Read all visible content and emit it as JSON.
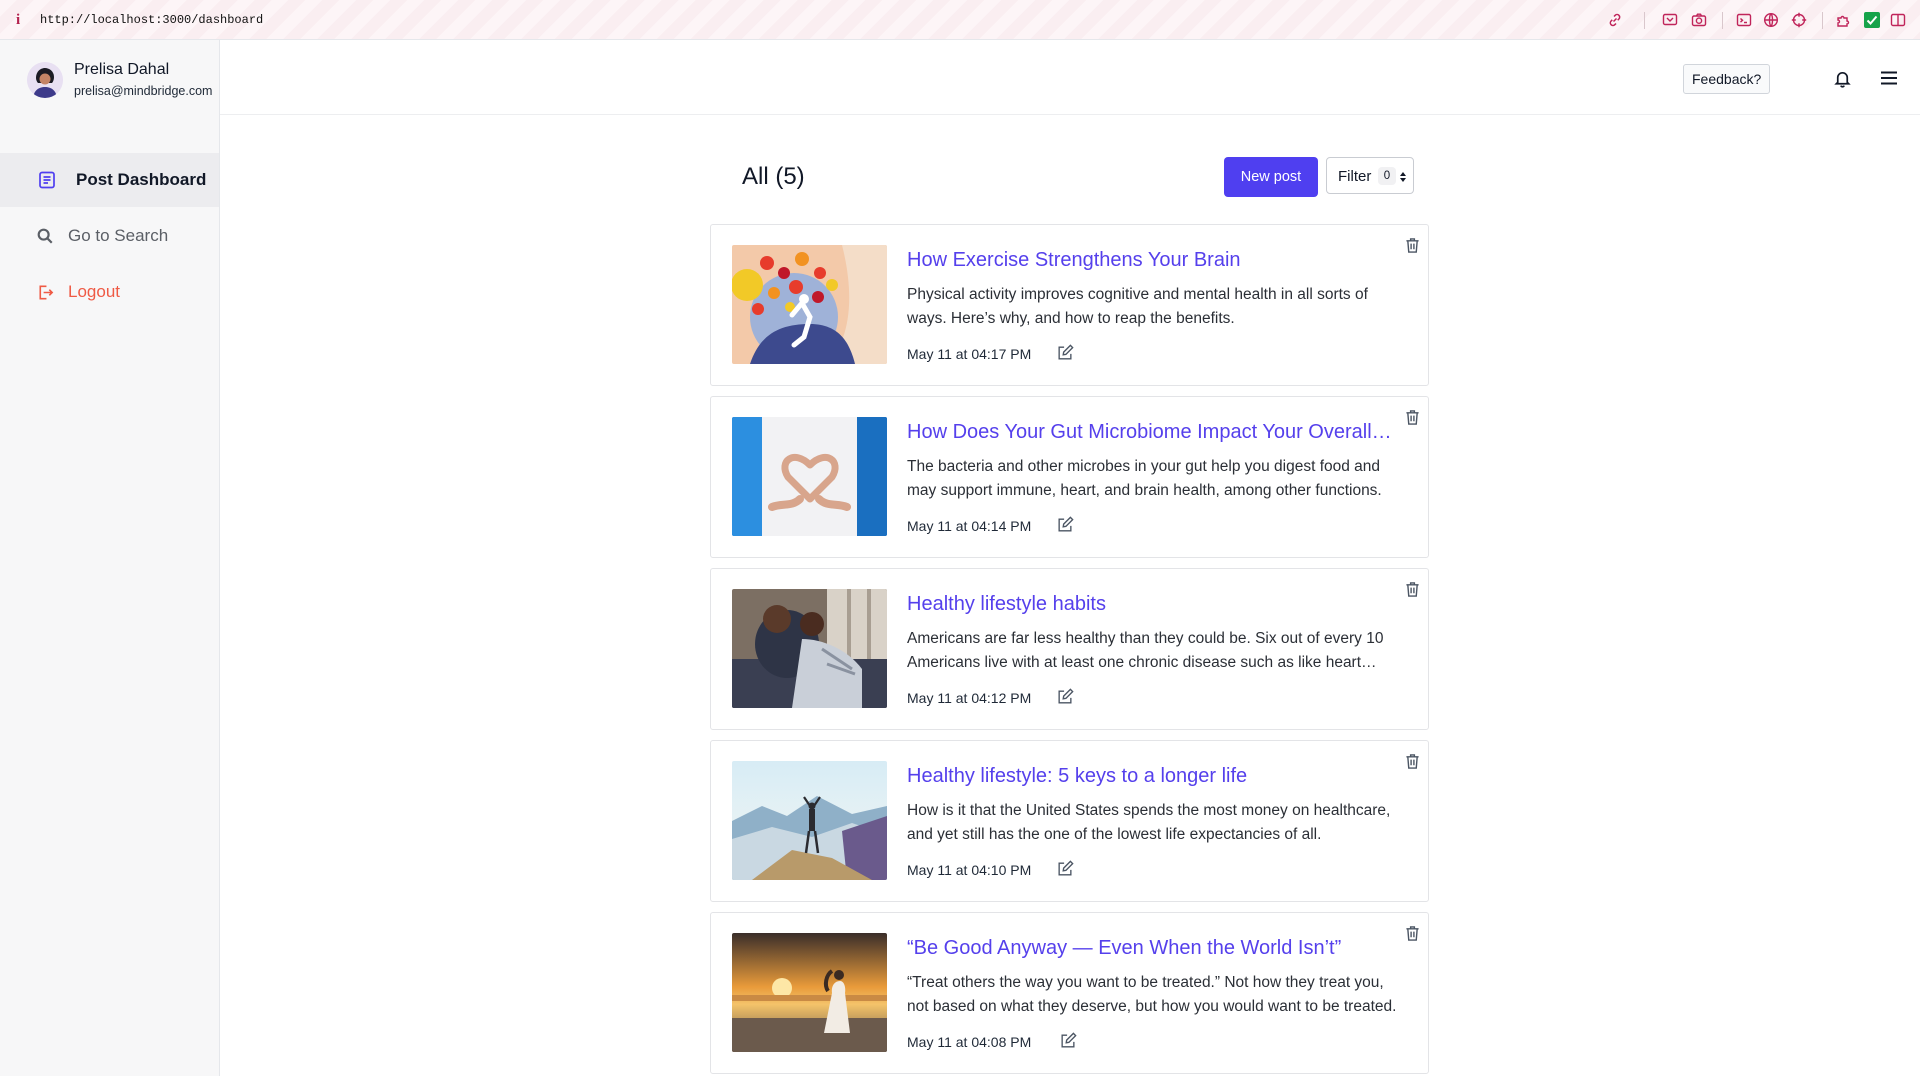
{
  "browser": {
    "url": "http://localhost:3000/dashboard"
  },
  "user": {
    "name": "Prelisa Dahal",
    "email": "prelisa@mindbridge.com"
  },
  "sidebar": {
    "items": [
      {
        "label": "Post Dashboard",
        "icon": "document-icon",
        "active": true
      },
      {
        "label": "Go to Search",
        "icon": "search-icon",
        "active": false
      },
      {
        "label": "Logout",
        "icon": "logout-icon",
        "active": false,
        "color": "#ef5a45"
      }
    ]
  },
  "header": {
    "feedback_label": "Feedback?"
  },
  "main": {
    "title": "All (5)",
    "new_post_label": "New post",
    "filter_label": "Filter",
    "filter_count": "0"
  },
  "posts": [
    {
      "title": "How Exercise Strengthens Your Brain",
      "excerpt": "Physical activity improves cognitive and mental health in all sorts of ways. Here’s why, and how to reap the benefits.",
      "date": "May 11 at 04:17 PM"
    },
    {
      "title": "How Does Your Gut Microbiome Impact Your Overall Health?",
      "excerpt": "The bacteria and other microbes in your gut help you digest food and may support immune, heart, and brain health, among other functions.",
      "date": "May 11 at 04:14 PM"
    },
    {
      "title": "Healthy lifestyle habits",
      "excerpt": "Americans are far less healthy than they could be. Six out of every 10 Americans live with at least one chronic disease such as like heart disease.",
      "date": "May 11 at 04:12 PM"
    },
    {
      "title": "Healthy lifestyle: 5 keys to a longer life",
      "excerpt": "How is it that the United States spends the most money on healthcare, and yet still has the one of the lowest life expectancies of all.",
      "date": "May 11 at 04:10 PM"
    },
    {
      "title": "“Be Good Anyway — Even When the World Isn’t”",
      "excerpt": "“Treat others the way you want to be treated.” Not how they treat you, not based on what they deserve, but how you would want to be treated.",
      "date": "May 11 at 04:08 PM"
    }
  ],
  "colors": {
    "accent": "#5540ec",
    "button": "#4f3ff0",
    "logout": "#ef5a45"
  }
}
